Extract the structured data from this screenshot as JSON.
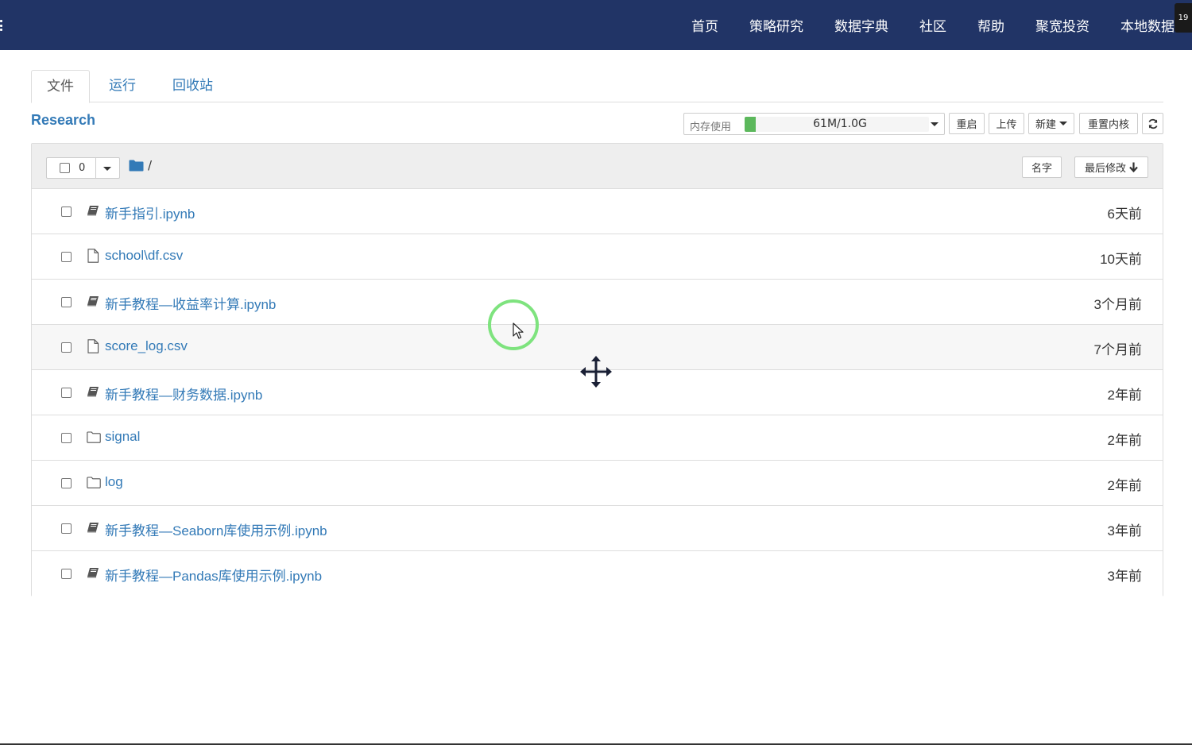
{
  "nav": {
    "items": [
      {
        "label": "首页"
      },
      {
        "label": "策略研究"
      },
      {
        "label": "数据字典"
      },
      {
        "label": "社区"
      },
      {
        "label": "帮助"
      },
      {
        "label": "聚宽投资"
      },
      {
        "label": "本地数据"
      }
    ],
    "badge": "19"
  },
  "tabs": [
    {
      "label": "文件",
      "active": true
    },
    {
      "label": "运行",
      "active": false
    },
    {
      "label": "回收站",
      "active": false
    }
  ],
  "project_title": "Research",
  "toolbar": {
    "memory_label": "内存使用",
    "memory_value": "61M/1.0G",
    "memory_fraction": 0.06,
    "restart_label": "重启",
    "upload_label": "上传",
    "new_label": "新建",
    "reset_kernel_label": "重置内核"
  },
  "list_header": {
    "selected_count": "0",
    "path": "/",
    "sort_name_label": "名字",
    "sort_modified_label": "最后修改"
  },
  "files": [
    {
      "name": "新手指引.ipynb",
      "type": "notebook",
      "modified": "6天前"
    },
    {
      "name": "school\\df.csv",
      "type": "file",
      "modified": "10天前"
    },
    {
      "name": "新手教程—收益率计算.ipynb",
      "type": "notebook",
      "modified": "3个月前"
    },
    {
      "name": "score_log.csv",
      "type": "file",
      "modified": "7个月前"
    },
    {
      "name": "新手教程—财务数据.ipynb",
      "type": "notebook",
      "modified": "2年前"
    },
    {
      "name": "signal",
      "type": "folder",
      "modified": "2年前"
    },
    {
      "name": "log",
      "type": "folder",
      "modified": "2年前"
    },
    {
      "name": "新手教程—Seaborn库使用示例.ipynb",
      "type": "notebook",
      "modified": "3年前"
    },
    {
      "name": "新手教程—Pandas库使用示例.ipynb",
      "type": "notebook",
      "modified": "3年前"
    }
  ],
  "colors": {
    "navbar": "#213466",
    "link": "#337ab7",
    "memory_bar": "#5cb85c",
    "click_ring": "#7ee37e"
  }
}
